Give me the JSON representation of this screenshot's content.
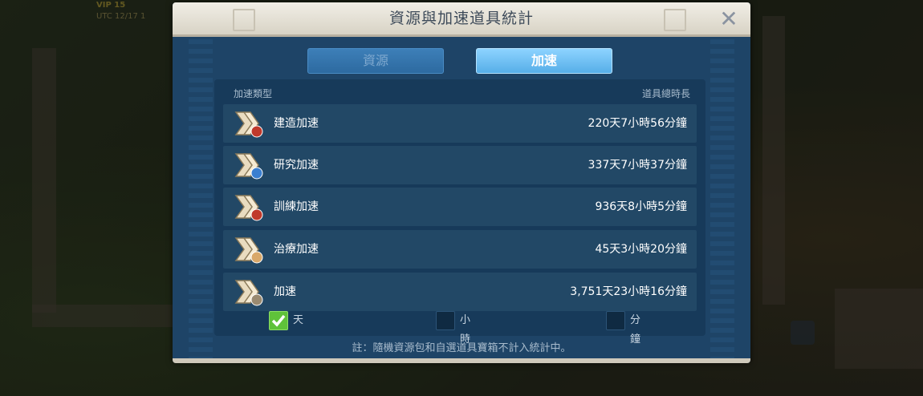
{
  "background": {
    "vip_text": "VIP 15",
    "clock_text": "UTC 12/17 1"
  },
  "dialog": {
    "title": "資源與加速道具統計",
    "close_glyph": "✕",
    "tabs": [
      {
        "label": "資源",
        "active": false
      },
      {
        "label": "加速",
        "active": true
      }
    ],
    "columns": {
      "type": "加速類型",
      "total": "道具總時長"
    },
    "rows": [
      {
        "label": "建造加速",
        "value": "220天7小時56分鐘",
        "icon": "construction-speedup-icon",
        "badge_color": "#c0392b"
      },
      {
        "label": "研究加速",
        "value": "337天7小時37分鐘",
        "icon": "research-speedup-icon",
        "badge_color": "#3b7fd0"
      },
      {
        "label": "訓練加速",
        "value": "936天8小時5分鐘",
        "icon": "training-speedup-icon",
        "badge_color": "#c0392b"
      },
      {
        "label": "治療加速",
        "value": "45天3小時20分鐘",
        "icon": "healing-speedup-icon",
        "badge_color": "#d9a86a"
      },
      {
        "label": "加速",
        "value": "3,751天23小時16分鐘",
        "icon": "universal-speedup-icon",
        "badge_color": "#9a8a70"
      }
    ],
    "units": [
      {
        "label": "天",
        "checked": true
      },
      {
        "label": "小時",
        "checked": false
      },
      {
        "label": "分鐘",
        "checked": false
      }
    ],
    "note": "註：隨機資源包和自選道具寶箱不計入統計中。"
  },
  "colors": {
    "panel": "#1e4467",
    "active_tab": "#56aee8",
    "checkbox_checked": "#5fc23a"
  }
}
